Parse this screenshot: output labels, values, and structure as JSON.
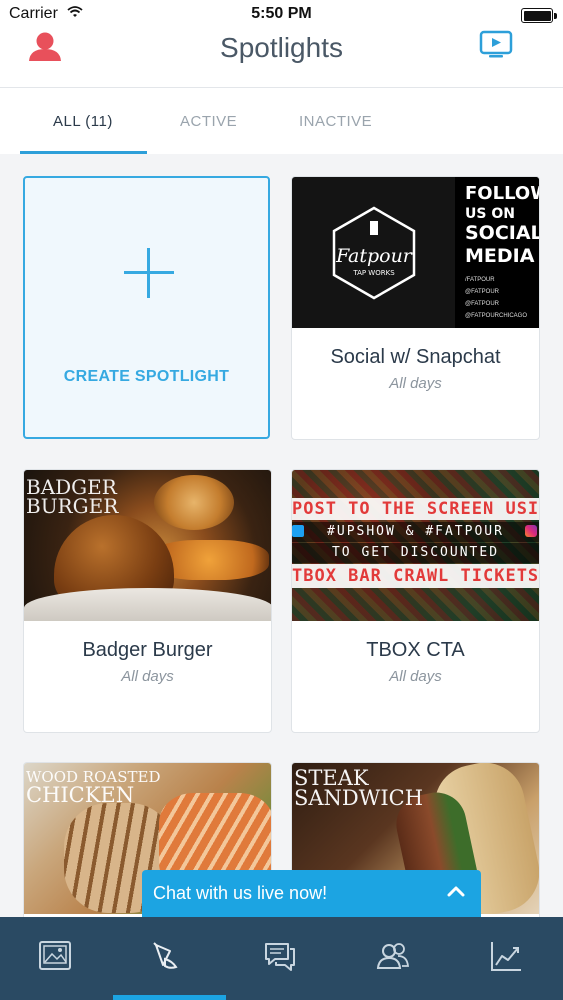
{
  "status_bar": {
    "carrier": "Carrier",
    "time": "5:50 PM"
  },
  "header": {
    "title": "Spotlights",
    "left_icon": "profile-icon",
    "right_icon": "tv-play-icon"
  },
  "tabs": [
    {
      "label": "ALL (11)",
      "active": true
    },
    {
      "label": "ACTIVE",
      "active": false
    },
    {
      "label": "INACTIVE",
      "active": false
    }
  ],
  "create_card": {
    "label": "CREATE SPOTLIGHT",
    "icon": "plus-icon"
  },
  "spotlights": [
    {
      "name": "Social w/ Snapchat",
      "days": "All days",
      "image": {
        "logo_line1": "Fatpour",
        "logo_line2": "TAP WORKS",
        "lines": [
          "FOLLOW",
          "US ON",
          "SOCIAL",
          "MEDIA"
        ],
        "handles": [
          "/FATPOUR",
          "@FATPOUR",
          "@FATPOUR",
          "@FATPOURCHICAGO"
        ]
      }
    },
    {
      "name": "Badger Burger",
      "days": "All days",
      "image": {
        "caption_line1": "BADGER",
        "caption_line2": "BURGER"
      }
    },
    {
      "name": "TBOX CTA",
      "days": "All days",
      "image": {
        "line1": "POST TO THE SCREEN USING",
        "line2": "#UPSHOW & #FATPOUR",
        "line3": "TO GET DISCOUNTED",
        "line4": "TBOX BAR CRAWL TICKETS"
      }
    },
    {
      "name": "Wood Roasted Chicken",
      "image": {
        "caption_line1": "WOOD ROASTED",
        "caption_line2": "CHICKEN"
      }
    },
    {
      "name": "Steak Sandwich",
      "image": {
        "caption_line1": "STEAK",
        "caption_line2": "SANDWICH"
      }
    }
  ],
  "chat_banner": {
    "label": "Chat with us live now!",
    "icon": "chevron-up-icon"
  },
  "tab_bar": [
    {
      "icon": "image-icon",
      "active": false
    },
    {
      "icon": "spotlight-icon",
      "active": true
    },
    {
      "icon": "chat-icon",
      "active": false
    },
    {
      "icon": "people-icon",
      "active": false
    },
    {
      "icon": "chart-icon",
      "active": false
    }
  ],
  "colors": {
    "accent": "#1ca4e2",
    "tab_bar_bg": "#2a4a63",
    "profile": "#e8505b"
  }
}
